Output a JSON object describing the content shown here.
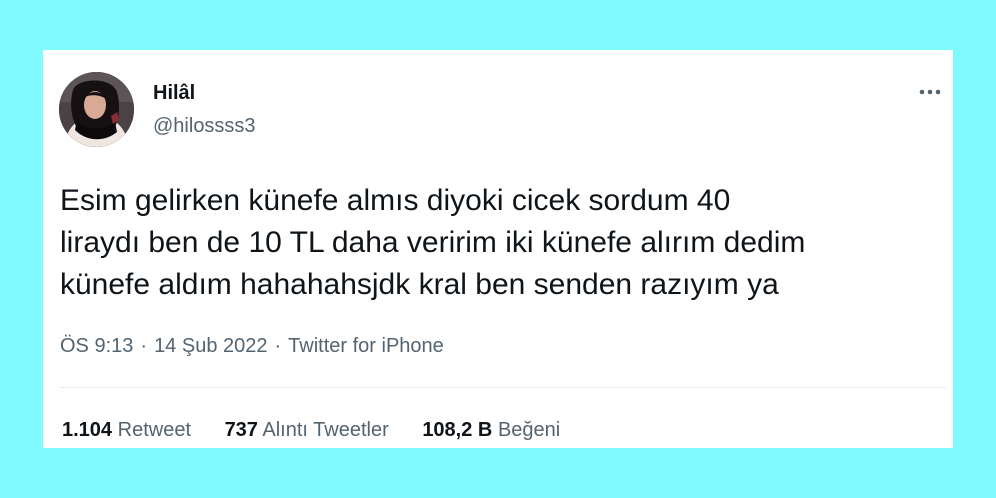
{
  "tweet": {
    "author": {
      "display_name": "Hilâl",
      "handle": "@hilossss3"
    },
    "text_lines": [
      "Esim gelirken künefe almıs diyoki cicek sordum 40",
      "liraydı ben de 10 TL daha veririm iki künefe alırım dedim",
      "künefe aldım hahahahsjdk kral ben senden razıyım ya"
    ],
    "meta": {
      "time": "ÖS 9:13",
      "separator": "·",
      "date": "14 Şub 2022",
      "source": "Twitter for iPhone"
    },
    "stats": [
      {
        "count": "1.104",
        "label": "Retweet"
      },
      {
        "count": "737",
        "label": "Alıntı Tweetler"
      },
      {
        "count": "108,2 B",
        "label": "Beğeni"
      }
    ],
    "more_icon": "more-horizontal-icon"
  },
  "colors": {
    "page_background": "#7ffbff",
    "card_background": "#ffffff",
    "primary_text": "#0f1419",
    "secondary_text": "#536471",
    "divider": "#e6ecf0"
  }
}
